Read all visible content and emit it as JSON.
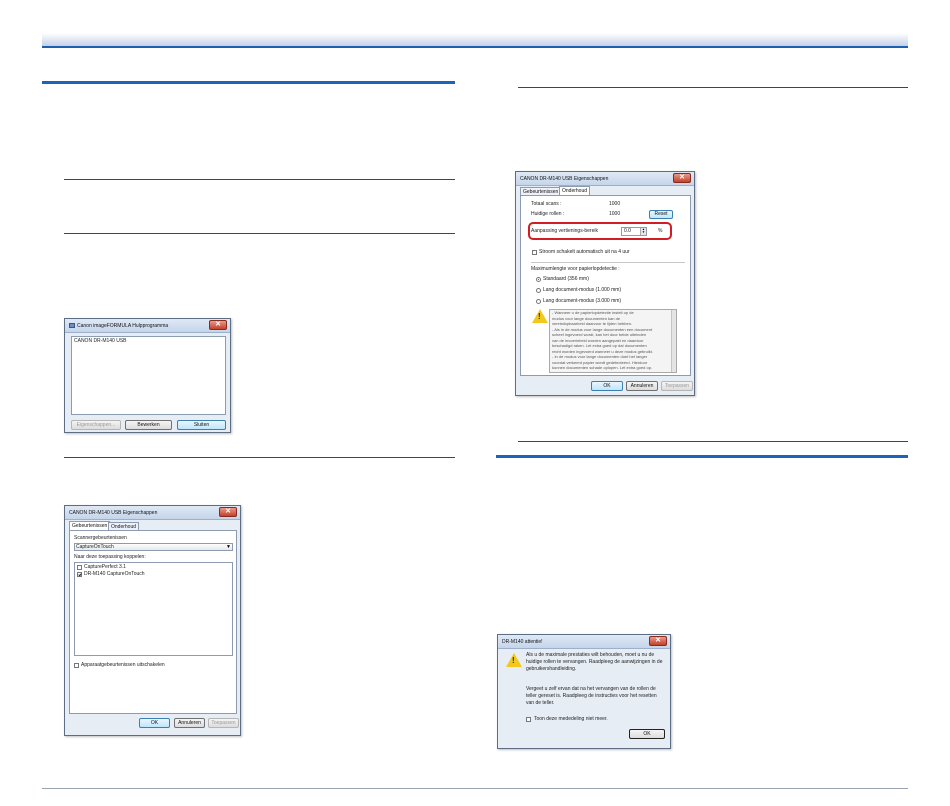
{
  "colors": {
    "accent": "#1c64b8",
    "highlight": "#d11d24",
    "warning": "#f2c81c"
  },
  "dialog_utility": {
    "title": "Canon imageFORMULA Hulpprogramma",
    "icon": "app-icon",
    "list_items": [
      "CANON DR-M140 USB"
    ],
    "buttons": {
      "properties": "Eigenschappen...",
      "edit": "Bewerken",
      "close": "Sluiten"
    }
  },
  "dialog_props_events": {
    "title": "CANON DR-M140 USB Eigenschappen",
    "tabs": [
      "Gebeurtenissen",
      "Onderhoud"
    ],
    "scanner_events_label": "Scannergebeurtenissen",
    "scanner_event_value": "CaptureOnTouch",
    "app_link_label": "Naar deze toepassing koppelen:",
    "apps": [
      {
        "label": "CapturePerfect 3.1",
        "checked": false
      },
      {
        "label": "DR-M140 CaptureOnTouch",
        "checked": true
      }
    ],
    "disable_events_label": "Apparaatgebeurtenissen uitschakelen",
    "buttons": {
      "ok": "OK",
      "cancel": "Annuleren",
      "apply": "Toepassen"
    }
  },
  "dialog_props_maintenance": {
    "title": "CANON DR-M140 USB Eigenschappen",
    "tabs": [
      "Gebeurtenissen",
      "Onderhoud"
    ],
    "total_scans_label": "Totaal scans :",
    "total_scans_value": "1000",
    "current_roller_label": "Huidige rollen :",
    "current_roller_value": "1000",
    "reset_button": "Reset",
    "adjust_label": "Aanpassing vertienings-bereik",
    "adjust_value": "0.0",
    "adjust_unit": "%",
    "power_off_label": "Stroom schakelt automatisch uit na 4 uur",
    "max_length_label": "Maximumlengte voor papierlopdetectie :",
    "options": [
      {
        "label": "Standaard (356 mm)",
        "selected": true
      },
      {
        "label": "Lang document-modus (1.000 mm)",
        "selected": false
      },
      {
        "label": "Lang document-modus (3.000 mm)",
        "selected": false
      }
    ],
    "note_lines": [
      "- Wanneer u de papierlopdetectie instelt op de",
      "modus voor lange documenten kan de",
      "vereistlopbaarheid daarvoor te lijden hebben.",
      "- Als in de modus voor lange documenten een document",
      "scheef ingevoerd wordt, kan het door beide uiteinden",
      "van de invoerinheid worden aangepakt en daardoor",
      "beschadigd raken. Let extra goed op dat documenten",
      "recht worden ingevoerd wanneer u deze modus gebruikt.",
      "- In de modus voor lange documenten doet het langer",
      "voordat verkeerd papier wordt gedetecteerd. Hierdoor",
      "kunnen documenten schade oplopen. Let extra goed op."
    ],
    "buttons": {
      "ok": "OK",
      "cancel": "Annuleren",
      "apply": "Toepassen"
    }
  },
  "dialog_alert": {
    "title": "DR-M140 attentie!",
    "message1_lines": [
      "Als u de maximale prestaties wilt behouden, moet u nu de",
      "huidige rollen te vervangen. Raadpleeg de aanwijzingen in de",
      "gebruikershandleiding."
    ],
    "message2_lines": [
      "Vergeet u zelf ervan dat na het vervangen van de rollen de",
      "teller gereset is. Raadpleeg de instructies voor het resetten",
      "van de teller."
    ],
    "dont_show_label": "Toon deze mededeling niet meer.",
    "ok_button": "OK"
  }
}
